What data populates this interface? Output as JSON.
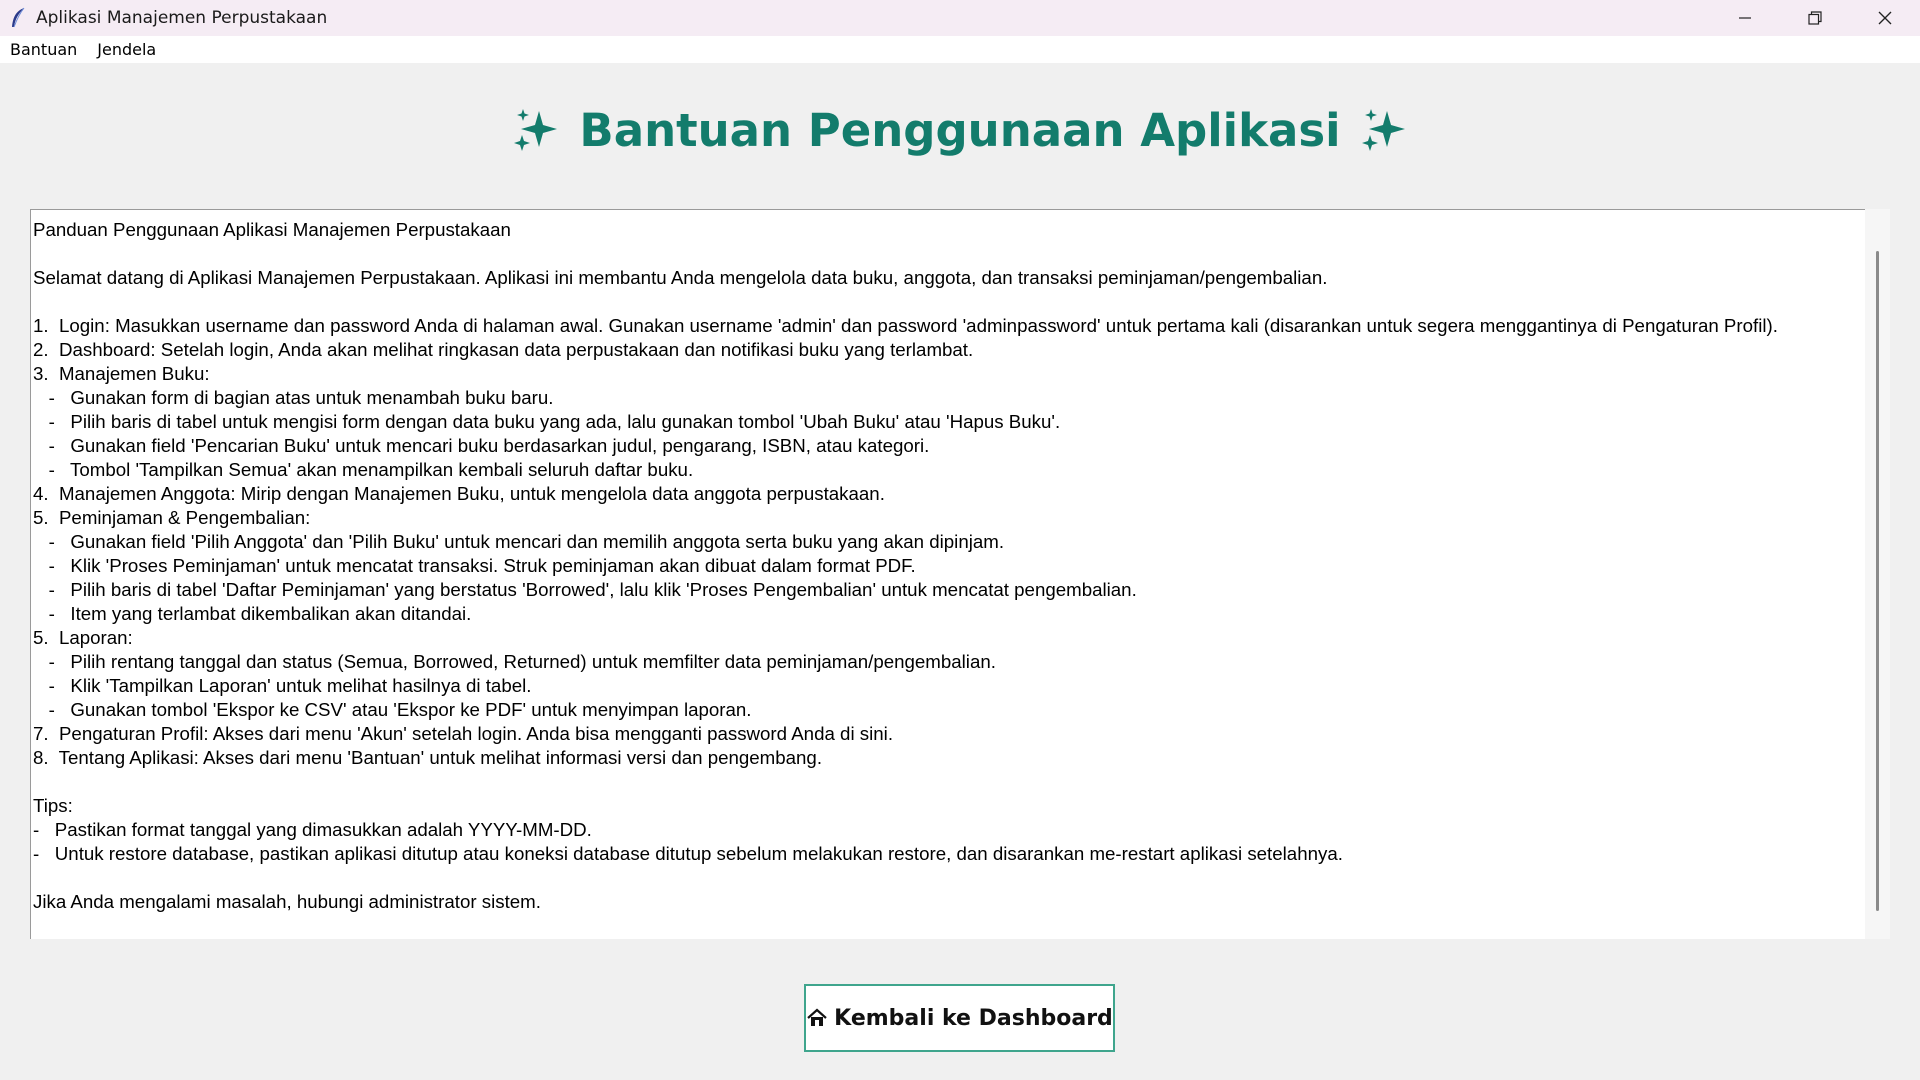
{
  "window": {
    "title": "Aplikasi Manajemen Perpustakaan",
    "controls": {
      "minimize": "—",
      "maximize": "❐",
      "close": "✕"
    }
  },
  "menu": {
    "items": [
      "Bantuan",
      "Jendela"
    ]
  },
  "page": {
    "heading": "Bantuan Penggunaan Aplikasi",
    "heading_icon": "sparkles-icon",
    "heading_color": "#137c6c"
  },
  "help": {
    "lines": [
      "Panduan Penggunaan Aplikasi Manajemen Perpustakaan",
      "",
      "Selamat datang di Aplikasi Manajemen Perpustakaan. Aplikasi ini membantu Anda mengelola data buku, anggota, dan transaksi peminjaman/pengembalian.",
      "",
      "1.  Login: Masukkan username dan password Anda di halaman awal. Gunakan username 'admin' dan password 'adminpassword' untuk pertama kali (disarankan untuk segera menggantinya di Pengaturan Profil).",
      "2.  Dashboard: Setelah login, Anda akan melihat ringkasan data perpustakaan dan notifikasi buku yang terlambat.",
      "3.  Manajemen Buku:",
      "   -   Gunakan form di bagian atas untuk menambah buku baru.",
      "   -   Pilih baris di tabel untuk mengisi form dengan data buku yang ada, lalu gunakan tombol 'Ubah Buku' atau 'Hapus Buku'.",
      "   -   Gunakan field 'Pencarian Buku' untuk mencari buku berdasarkan judul, pengarang, ISBN, atau kategori.",
      "   -   Tombol 'Tampilkan Semua' akan menampilkan kembali seluruh daftar buku.",
      "4.  Manajemen Anggota: Mirip dengan Manajemen Buku, untuk mengelola data anggota perpustakaan.",
      "5.  Peminjaman & Pengembalian:",
      "   -   Gunakan field 'Pilih Anggota' dan 'Pilih Buku' untuk mencari dan memilih anggota serta buku yang akan dipinjam.",
      "   -   Klik 'Proses Peminjaman' untuk mencatat transaksi. Struk peminjaman akan dibuat dalam format PDF.",
      "   -   Pilih baris di tabel 'Daftar Peminjaman' yang berstatus 'Borrowed', lalu klik 'Proses Pengembalian' untuk mencatat pengembalian.",
      "   -   Item yang terlambat dikembalikan akan ditandai.",
      "5.  Laporan:",
      "   -   Pilih rentang tanggal dan status (Semua, Borrowed, Returned) untuk memfilter data peminjaman/pengembalian.",
      "   -   Klik 'Tampilkan Laporan' untuk melihat hasilnya di tabel.",
      "   -   Gunakan tombol 'Ekspor ke CSV' atau 'Ekspor ke PDF' untuk menyimpan laporan.",
      "7.  Pengaturan Profil: Akses dari menu 'Akun' setelah login. Anda bisa mengganti password Anda di sini.",
      "8.  Tentang Aplikasi: Akses dari menu 'Bantuan' untuk melihat informasi versi dan pengembang.",
      "",
      "Tips:",
      "-   Pastikan format tanggal yang dimasukkan adalah YYYY-MM-DD.",
      "-   Untuk restore database, pastikan aplikasi ditutup atau koneksi database ditutup sebelum melakukan restore, dan disarankan me-restart aplikasi setelahnya.",
      "",
      "Jika Anda mengalami masalah, hubungi administrator sistem."
    ]
  },
  "back_button": {
    "label": "Kembali ke Dashboard",
    "icon": "house-icon",
    "border_color": "#3fa58d"
  }
}
